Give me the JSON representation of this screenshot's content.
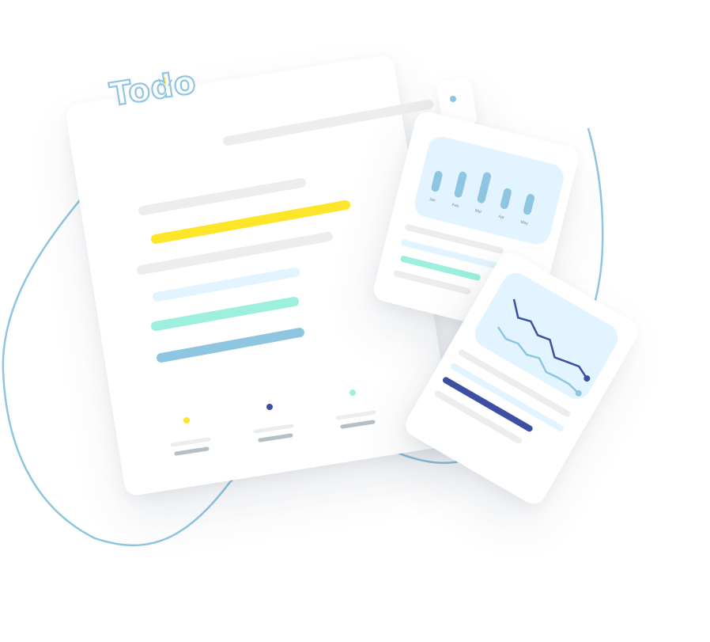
{
  "brand": {
    "logo_text": "Todo"
  },
  "bar_chart": {
    "categories": [
      "Jan",
      "Feb",
      "Mar",
      "Apr",
      "May"
    ],
    "values": [
      4,
      5,
      6,
      4,
      4
    ],
    "type": "bar"
  },
  "chart_data": {
    "type": "line",
    "series": [
      {
        "values": [
          4.0,
          2.7,
          3.0,
          2.2,
          2.4,
          1.2,
          1.4,
          1.6,
          1.0
        ]
      },
      {
        "values": [
          2.2,
          1.6,
          1.8,
          1.3,
          1.6,
          0.8,
          0.9,
          0.9,
          0.6
        ]
      }
    ]
  },
  "colors": {
    "accent_blue": "#8ec5e0",
    "yellow": "#fde52a",
    "mint": "#9cf0dd",
    "navy": "#3c4fa2",
    "light_blue": "#e2f4ff",
    "grey_line": "#ededed",
    "grey_dark": "#b4c0c6"
  },
  "legend": [
    {
      "name": "legend-yellow",
      "color": "#fde52a"
    },
    {
      "name": "legend-navy",
      "color": "#3c4fa2"
    },
    {
      "name": "legend-mint",
      "color": "#9cf0dd"
    }
  ]
}
